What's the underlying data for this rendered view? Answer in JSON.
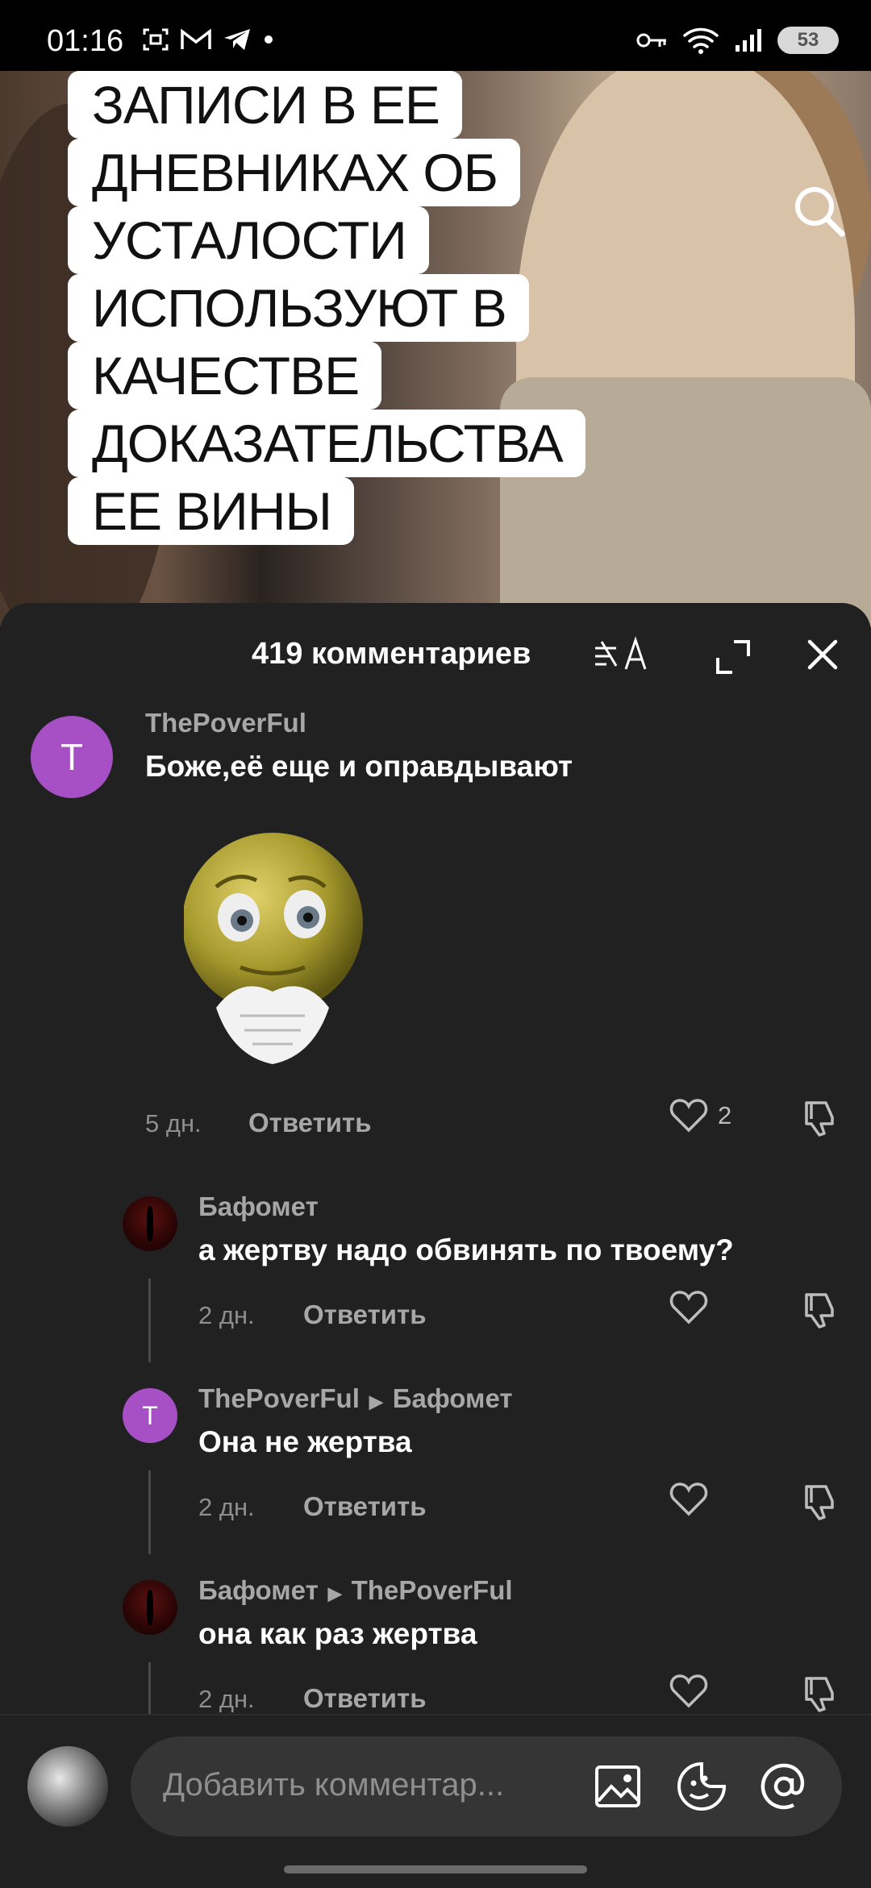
{
  "status_bar": {
    "time": "01:16",
    "battery": "53"
  },
  "video": {
    "caption_lines": [
      "ЗАПИСИ В ЕЕ",
      "ДНЕВНИКАХ ОБ",
      "УСТАЛОСТИ",
      "ИСПОЛЬЗУЮТ В",
      "КАЧЕСТВЕ",
      "ДОКАЗАТЕЛЬСТВА",
      "ЕЕ ВИНЫ"
    ]
  },
  "comments_sheet": {
    "title": "419 комментариев",
    "comments": [
      {
        "avatar_letter": "T",
        "username": "ThePoverFul",
        "text": "Боже,её еще и оправдывают",
        "time": "5 дн.",
        "reply_label": "Ответить",
        "likes": "2",
        "has_sticker": true
      },
      {
        "username": "Бафомет",
        "text": "а жертву надо обвинять по твоему?",
        "time": "2 дн.",
        "reply_label": "Ответить"
      },
      {
        "avatar_letter": "T",
        "username": "ThePoverFul",
        "reply_to": "Бафомет",
        "text": "Она не жертва",
        "time": "2 дн.",
        "reply_label": "Ответить"
      },
      {
        "username": "Бафомет",
        "reply_to": "ThePoverFul",
        "text": "она как раз жертва",
        "time": "2 дн.",
        "reply_label": "Ответить"
      }
    ]
  },
  "composer": {
    "placeholder": "Добавить комментар..."
  },
  "colors": {
    "sheet_bg": "#212121",
    "avatar_purple": "#a74fc4"
  }
}
